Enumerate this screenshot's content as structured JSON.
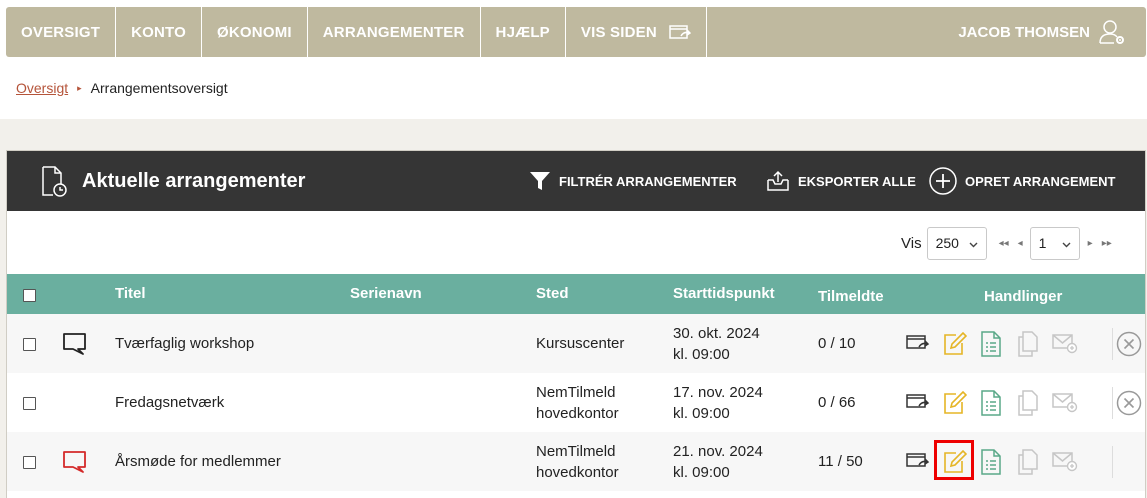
{
  "nav": {
    "items": [
      {
        "label": "OVERSIGT"
      },
      {
        "label": "KONTO"
      },
      {
        "label": "ØKONOMI"
      },
      {
        "label": "ARRANGEMENTER"
      },
      {
        "label": "HJÆLP"
      },
      {
        "label": "VIS SIDEN"
      }
    ],
    "user": "JACOB THOMSEN"
  },
  "breadcrumb": {
    "root": "Oversigt",
    "separator": "▸",
    "current": "Arrangementsoversigt"
  },
  "panel": {
    "title": "Aktuelle arrangementer",
    "actions": {
      "filter": "FILTRÉR ARRANGEMENTER",
      "export": "EKSPORTER ALLE",
      "create": "OPRET ARRANGEMENT"
    }
  },
  "pager": {
    "label": "Vis",
    "page_size": "250",
    "page": "1",
    "first": "◂◂",
    "prev": "◂",
    "next": "▸",
    "last": "▸▸"
  },
  "table": {
    "columns": {
      "title": "Titel",
      "series": "Serienavn",
      "location": "Sted",
      "start": "Starttidspunkt",
      "registered": "Tilmeldte",
      "actions": "Handlinger"
    },
    "rows": [
      {
        "comment_icon": "speech-bubble-icon",
        "comment_color": "#222222",
        "title": "Tværfaglig workshop",
        "series": "",
        "location_line1": "Kursuscenter",
        "location_line2": "",
        "start_date": "30. okt. 2024",
        "start_time": "kl. 09:00",
        "registered": "0 / 10",
        "has_delete": true
      },
      {
        "comment_icon": "",
        "comment_color": "",
        "title": "Fredagsnetværk",
        "series": "",
        "location_line1": "NemTilmeld",
        "location_line2": "hovedkontor",
        "start_date": "17. nov. 2024",
        "start_time": "kl. 09:00",
        "registered": "0 / 66",
        "has_delete": true
      },
      {
        "comment_icon": "speech-bubble-icon",
        "comment_color": "#d42a2a",
        "title": "Årsmøde for medlemmer",
        "series": "",
        "location_line1": "NemTilmeld",
        "location_line2": "hovedkontor",
        "start_date": "21. nov. 2024",
        "start_time": "kl. 09:00",
        "registered": "11 / 50",
        "has_delete": false
      }
    ]
  },
  "colors": {
    "nav_bg": "#bfb99f",
    "header_bg": "#353535",
    "table_header_bg": "#6aaf9f",
    "link": "#b5543a",
    "edit_icon": "#e5b526",
    "list_icon": "#5aa888",
    "highlight": "#ee0000"
  }
}
